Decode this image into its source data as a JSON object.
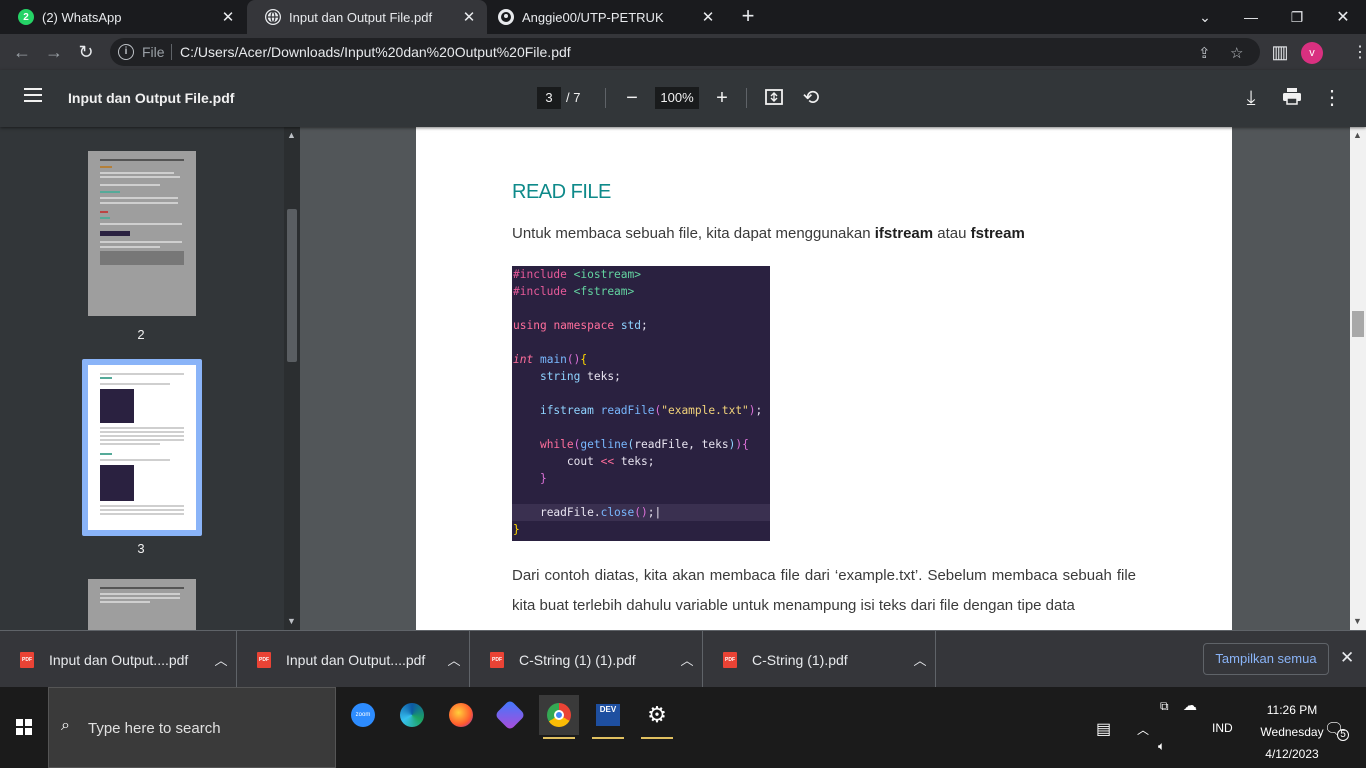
{
  "browser": {
    "tabs": [
      {
        "title": "(2) WhatsApp",
        "icon": "whatsapp-icon",
        "badge": "2"
      },
      {
        "title": "Input dan Output File.pdf",
        "icon": "globe-icon"
      },
      {
        "title": "Anggie00/UTP-PETRUK",
        "icon": "github-icon"
      }
    ],
    "address": {
      "scheme": "File",
      "url": "C:/Users/Acer/Downloads/Input%20dan%20Output%20File.pdf"
    },
    "profile_initial": "v"
  },
  "pdf": {
    "title": "Input dan Output File.pdf",
    "current_page": "3",
    "total_pages": "/ 7",
    "zoom": "100%",
    "thumbnails": [
      {
        "label": "2"
      },
      {
        "label": "3"
      }
    ],
    "content": {
      "heading": "READ FILE",
      "intro_prefix": "Untuk membaca sebuah file, kita dapat menggunakan ",
      "intro_bold1": "ifstream",
      "intro_mid": " atau ",
      "intro_bold2": "fstream",
      "paragraph": "Dari contoh diatas, kita akan membaca file dari ‘example.txt’. Sebelum membaca sebuah file kita buat terlebih dahulu variable untuk menampung isi teks dari file dengan tipe data"
    }
  },
  "downloads": {
    "items": [
      {
        "name": "Input dan Output....pdf"
      },
      {
        "name": "Input dan Output....pdf"
      },
      {
        "name": "C-String (1) (1).pdf"
      },
      {
        "name": "C-String (1).pdf"
      }
    ],
    "show_all": "Tampilkan semua"
  },
  "taskbar": {
    "search_placeholder": "Type here to search",
    "lang": "IND",
    "time": "11:26 PM",
    "day": "Wednesday",
    "date": "4/12/2023",
    "notifications": "5",
    "zoom_label": "zoom",
    "dev_label": "DEV"
  },
  "colors": {
    "accent": "#8ab4f8",
    "heading": "#0e8a8a",
    "code_bg": "#2a2140"
  }
}
